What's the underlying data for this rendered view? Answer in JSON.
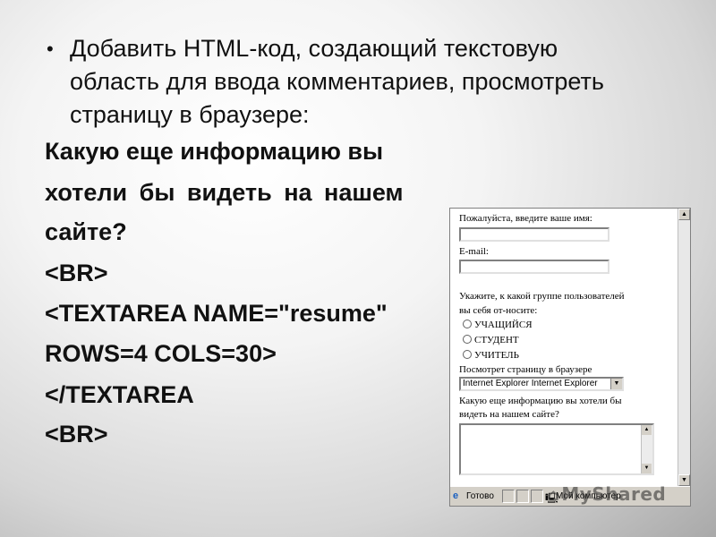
{
  "slide": {
    "bullet_text": "Добавить HTML-код, создающий текстовую область для ввода комментариев, просмотреть страницу в браузере:",
    "code_lines": [
      "Какую еще информацию вы",
      "хотели бы видеть на нашем",
      "сайте?",
      "<BR>",
      "<TEXTAREA NAME=\"resume\"",
      "ROWS=4 COLS=30>",
      "</TEXTAREA",
      "<BR>"
    ]
  },
  "browser": {
    "name_label": "Пожалуйста, введите ваше имя:",
    "email_label": "E-mail:",
    "group_label_1": "Укажите, к какой группе пользователей",
    "group_label_2": "вы себя от-носите:",
    "radio_options": [
      "УЧАЩИЙСЯ",
      "СТУДЕНТ",
      "УЧИТЕЛЬ"
    ],
    "browser_label": "Посмотрет страницу в браузере",
    "select_value": "Internet Explorer Internet Explorer",
    "comment_label_1": "Какую еще информацию вы хотели бы",
    "comment_label_2": "видеть на нашем сайте?",
    "status_text": "Готово",
    "zone_text": "Мой компьютер"
  },
  "watermark": "MyShared",
  "icons": [
    "bullet-dot-icon",
    "radio-icon",
    "dropdown-arrow-icon",
    "ie-icon",
    "computer-icon",
    "scroll-up-icon",
    "scroll-down-icon"
  ]
}
